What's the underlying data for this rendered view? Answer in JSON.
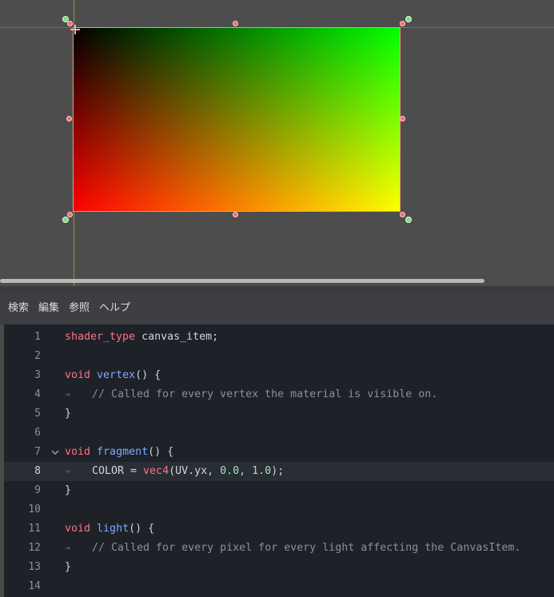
{
  "colors": {
    "keyword": "#ff7085",
    "function": "#7fa8ff",
    "number": "#a0e0b8",
    "comment": "#8a8f99",
    "text": "#cfd4dc",
    "editor_bg": "#1e2228"
  },
  "menubar": {
    "items": [
      "検索",
      "編集",
      "参照",
      "ヘルプ"
    ]
  },
  "editor": {
    "current_line": 8,
    "lines": [
      {
        "n": "1",
        "kw": "shader_type",
        "rest": " canvas_item;"
      },
      {
        "n": "2"
      },
      {
        "n": "3",
        "kw": "void",
        "fn": "vertex",
        "rest": "() {"
      },
      {
        "n": "4",
        "comment": "// Called for every vertex the material is visible on."
      },
      {
        "n": "5",
        "rest": "}"
      },
      {
        "n": "6"
      },
      {
        "n": "7",
        "kw": "void",
        "fn": "fragment",
        "rest": "() {"
      },
      {
        "n": "8",
        "p1": "COLOR = ",
        "kw2": "vec4",
        "p2": "(UV.yx, ",
        "num1": "0.0",
        "p3": ", ",
        "num2": "1.0",
        "p4": ");"
      },
      {
        "n": "9",
        "rest": "}"
      },
      {
        "n": "10"
      },
      {
        "n": "11",
        "kw": "void",
        "fn": "light",
        "rest": "() {"
      },
      {
        "n": "12",
        "comment": "// Called for every pixel for every light affecting the CanvasItem."
      },
      {
        "n": "13",
        "rest": "}"
      },
      {
        "n": "14"
      }
    ]
  }
}
